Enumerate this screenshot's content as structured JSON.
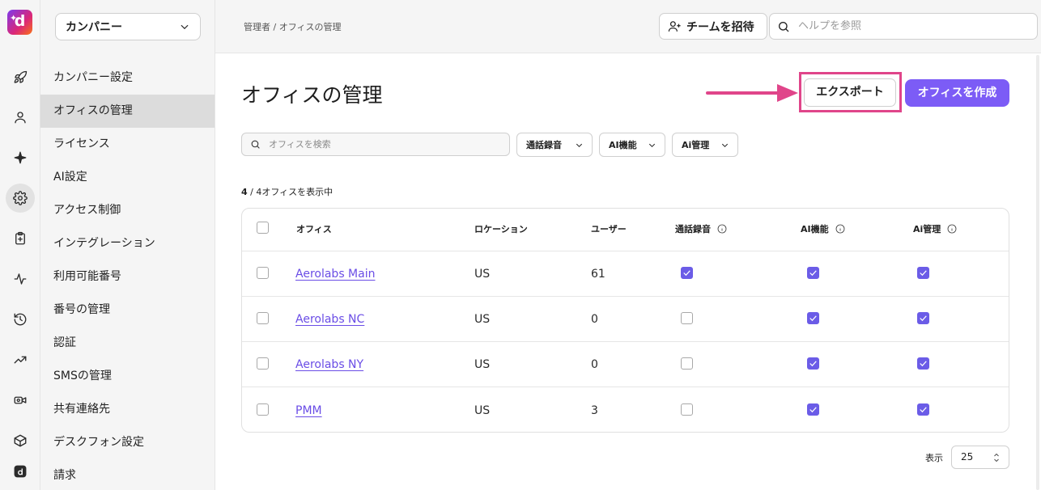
{
  "app": {
    "logo_letter": "d"
  },
  "company_selector": {
    "value": "カンパニー"
  },
  "sidebar": {
    "items": [
      {
        "label": "カンパニー設定",
        "active": false
      },
      {
        "label": "オフィスの管理",
        "active": true
      },
      {
        "label": "ライセンス",
        "active": false
      },
      {
        "label": "AI設定",
        "active": false
      },
      {
        "label": "アクセス制御",
        "active": false
      },
      {
        "label": "インテグレーション",
        "active": false
      },
      {
        "label": "利用可能番号",
        "active": false
      },
      {
        "label": "番号の管理",
        "active": false
      },
      {
        "label": "認証",
        "active": false
      },
      {
        "label": "SMSの管理",
        "active": false
      },
      {
        "label": "共有連絡先",
        "active": false
      },
      {
        "label": "デスクフォン設定",
        "active": false
      },
      {
        "label": "請求",
        "active": false
      }
    ]
  },
  "rail_icons": [
    "rocket-icon",
    "user-icon",
    "sparkle-icon",
    "gear-icon",
    "clipboard-icon",
    "activity-icon",
    "history-icon",
    "trending-icon",
    "video-icon",
    "box-icon",
    "desktop-app-icon"
  ],
  "header": {
    "breadcrumb": "管理者 / オフィスの管理",
    "invite_label": "チームを招待",
    "help_placeholder": "ヘルプを参照"
  },
  "main": {
    "title": "オフィスの管理",
    "export_label": "エクスポート",
    "create_label": "オフィスを作成",
    "search_placeholder": "オフィスを検索",
    "filters": [
      "通話録音",
      "AI機能",
      "Ai管理"
    ],
    "count_bold": "4",
    "count_rest": " / 4オフィスを表示中"
  },
  "table": {
    "columns": [
      "オフィス",
      "ロケーション",
      "ユーザー",
      "通話録音",
      "AI機能",
      "Ai管理"
    ],
    "rows": [
      {
        "office": "Aerolabs Main",
        "location": "US",
        "users": "61",
        "call_recording": true,
        "ai_features": true,
        "ai_admin": true
      },
      {
        "office": "Aerolabs NC",
        "location": "US",
        "users": "0",
        "call_recording": false,
        "ai_features": true,
        "ai_admin": true
      },
      {
        "office": "Aerolabs NY",
        "location": "US",
        "users": "0",
        "call_recording": false,
        "ai_features": true,
        "ai_admin": true
      },
      {
        "office": "PMM",
        "location": "US",
        "users": "3",
        "call_recording": false,
        "ai_features": true,
        "ai_admin": true
      }
    ]
  },
  "pagination": {
    "label": "表示",
    "page_size": "25"
  },
  "colors": {
    "accent": "#7c5cf6",
    "highlight": "#e0458a",
    "link": "#6a4de6"
  }
}
